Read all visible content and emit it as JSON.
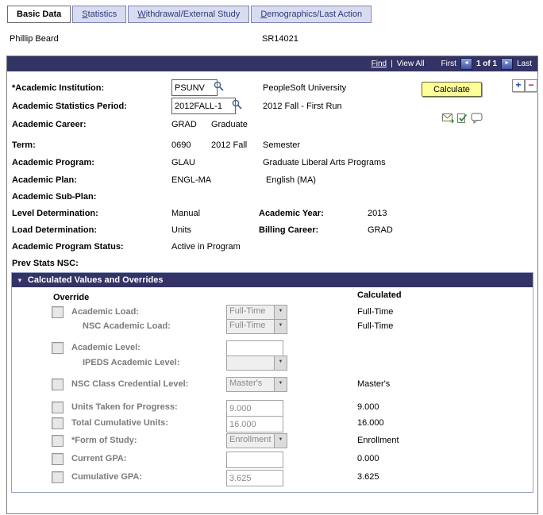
{
  "tabs": [
    {
      "label": "Basic Data"
    },
    {
      "label": "Statistics"
    },
    {
      "label": "Withdrawal/External Study"
    },
    {
      "label": "Demographics/Last Action"
    }
  ],
  "person": {
    "name": "Phillip Beard",
    "id": "SR14021"
  },
  "navbar": {
    "find": "Find",
    "separator": "|",
    "view_all": "View All",
    "first": "First",
    "page": "1 of 1",
    "last": "Last"
  },
  "icons": {
    "prev": "◄",
    "next": "►",
    "collapse": "▼",
    "dropdown": "▼",
    "add": "+",
    "remove": "−"
  },
  "actions": {
    "calculate": "Calculate"
  },
  "fields": {
    "institution": {
      "label": "*Academic Institution:",
      "value": "PSUNV",
      "desc": "PeopleSoft University"
    },
    "stats_period": {
      "label": "Academic Statistics Period:",
      "value": "2012FALL-1",
      "desc": "2012 Fall - First Run"
    },
    "career": {
      "label": "Academic Career:",
      "value": "GRAD",
      "desc": "Graduate"
    },
    "term": {
      "label": "Term:",
      "value": "0690",
      "value2": "2012 Fall",
      "desc": "Semester"
    },
    "program": {
      "label": "Academic Program:",
      "value": "GLAU",
      "desc": "Graduate Liberal Arts Programs"
    },
    "plan": {
      "label": "Academic Plan:",
      "value": "ENGL-MA",
      "desc": "English (MA)"
    },
    "subplan": {
      "label": "Academic Sub-Plan:"
    },
    "level_determination": {
      "label": "Level Determination:",
      "value": "Manual"
    },
    "academic_year": {
      "label": "Academic Year:",
      "value": "2013"
    },
    "load_determination": {
      "label": "Load Determination:",
      "value": "Units"
    },
    "billing_career": {
      "label": "Billing Career:",
      "value": "GRAD"
    },
    "program_status": {
      "label": "Academic Program Status:",
      "value": "Active in Program"
    },
    "prev_stats_nsc": {
      "label": "Prev Stats NSC:"
    }
  },
  "overrides": {
    "title": "Calculated Values and Overrides",
    "col_override": "Override",
    "col_calculated": "Calculated",
    "rows": [
      {
        "label": "Academic Load:",
        "value": "Full-Time",
        "calculated": "Full-Time",
        "checked": false
      },
      {
        "label": "NSC Academic Load:",
        "value": "Full-Time",
        "calculated": "Full-Time"
      },
      {
        "label": "Academic Level:",
        "value": "",
        "calculated": "",
        "checked": false
      },
      {
        "label": "IPEDS Academic Level:",
        "value": "",
        "calculated": ""
      },
      {
        "label": "NSC Class Credential Level:",
        "value": "Master's",
        "calculated": "Master's",
        "checked": false
      },
      {
        "label": "Units Taken for Progress:",
        "value": "9.000",
        "calculated": "9.000",
        "checked": false
      },
      {
        "label": "Total Cumulative Units:",
        "value": "16.000",
        "calculated": "16.000",
        "checked": false
      },
      {
        "label": "*Form of Study:",
        "value": "Enrollment",
        "calculated": "Enrollment",
        "checked": false
      },
      {
        "label": "Current GPA:",
        "value": "",
        "calculated": "0.000",
        "checked": false
      },
      {
        "label": "Cumulative GPA:",
        "value": "3.625",
        "calculated": "3.625",
        "checked": false
      }
    ]
  }
}
